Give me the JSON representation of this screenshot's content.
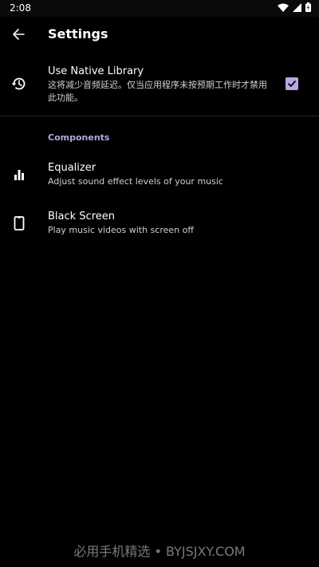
{
  "status_bar": {
    "time": "2:08",
    "icons": [
      "wifi-icon",
      "signal-icon",
      "battery-icon"
    ]
  },
  "appbar": {
    "back_icon": "arrow-left-icon",
    "title": "Settings"
  },
  "native_library": {
    "icon": "history-icon",
    "title": "Use Native Library",
    "summary": "这将减少音频延迟。仅当应用程序未按预期工作时才禁用此功能。",
    "checked": true
  },
  "components": {
    "header": "Components",
    "items": [
      {
        "icon": "equalizer-icon",
        "title": "Equalizer",
        "summary": "Adjust sound effect levels of your music"
      },
      {
        "icon": "phone-icon",
        "title": "Black Screen",
        "summary": "Play music videos with screen off"
      }
    ]
  },
  "watermark": "必用手机精选 • BYJSJXY.COM",
  "colors": {
    "background": "#000000",
    "accent": "#b9a6e3",
    "text_primary": "#ffffff",
    "text_secondary": "#cfcfcf"
  }
}
